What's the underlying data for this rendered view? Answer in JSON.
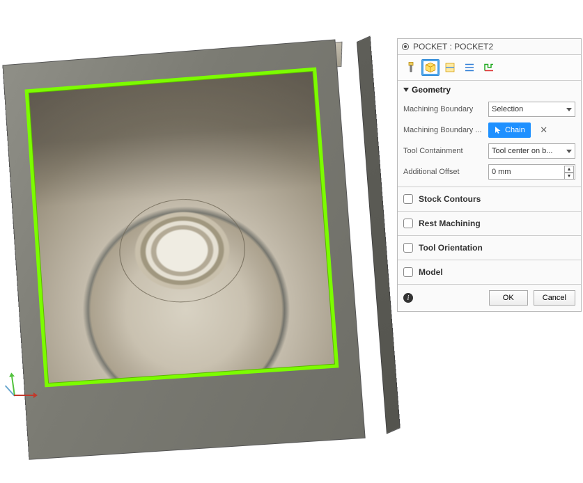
{
  "panel": {
    "title": "POCKET : POCKET2",
    "tabs": [
      "tool-tab",
      "geometry-tab",
      "heights-tab",
      "passes-tab",
      "linking-tab"
    ],
    "active_tab": 1,
    "geometry": {
      "heading": "Geometry",
      "machining_boundary_label": "Machining Boundary",
      "machining_boundary_value": "Selection",
      "machining_boundary_sel_label": "Machining Boundary ...",
      "chain_label": "Chain",
      "tool_containment_label": "Tool Containment",
      "tool_containment_value": "Tool center on b...",
      "additional_offset_label": "Additional Offset",
      "additional_offset_value": "0 mm"
    },
    "sections": {
      "stock_contours": "Stock Contours",
      "rest_machining": "Rest Machining",
      "tool_orientation": "Tool Orientation",
      "model": "Model"
    },
    "buttons": {
      "ok": "OK",
      "cancel": "Cancel"
    }
  },
  "viewport": {
    "selection_color": "#7CFC00"
  }
}
